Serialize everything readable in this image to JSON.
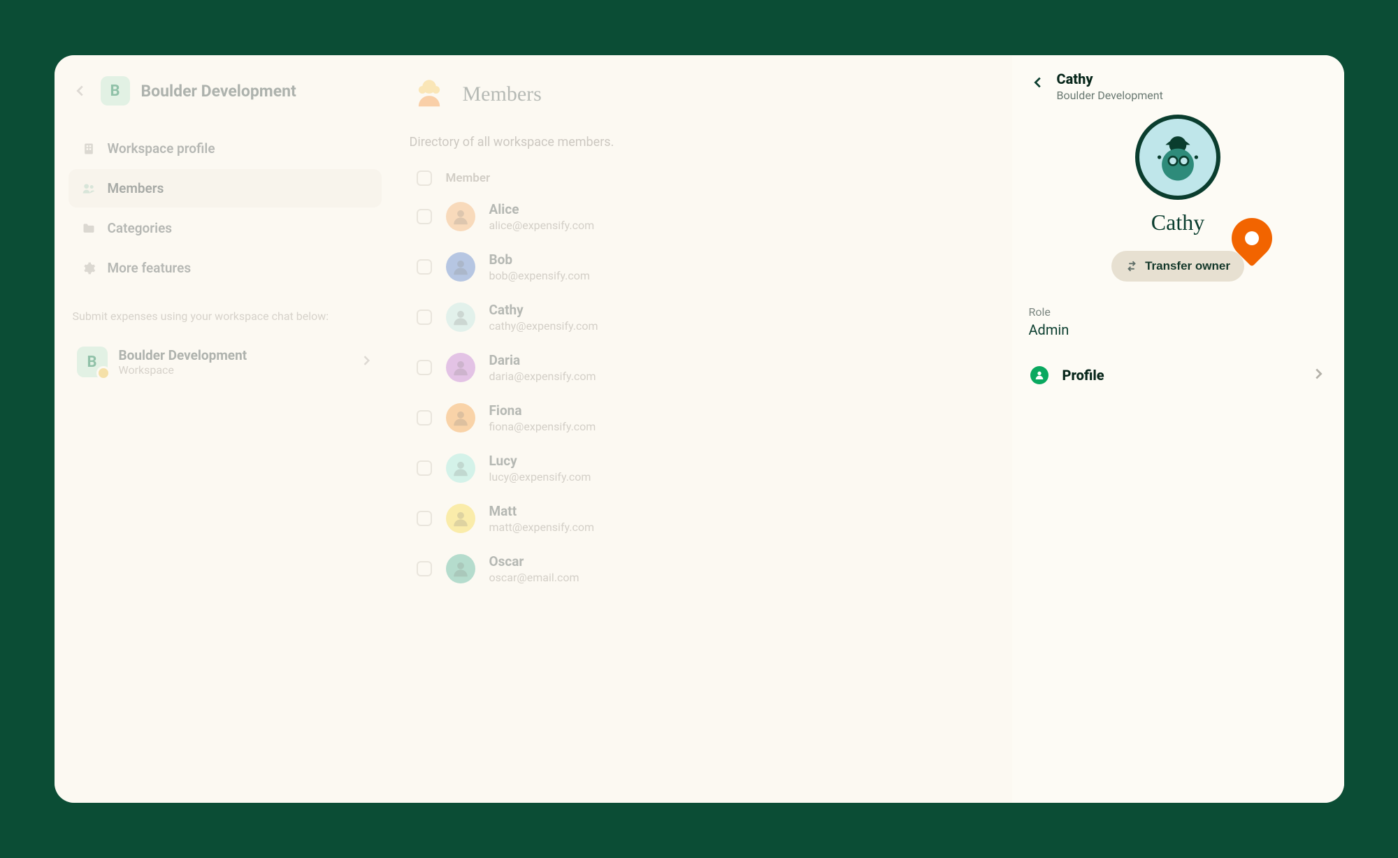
{
  "workspace": {
    "initial": "B",
    "name": "Boulder Development"
  },
  "sidebar": {
    "items": [
      {
        "label": "Workspace profile"
      },
      {
        "label": "Members"
      },
      {
        "label": "Categories"
      },
      {
        "label": "More features"
      }
    ],
    "hint": "Submit expenses using your workspace chat below:",
    "chat": {
      "initial": "B",
      "title": "Boulder Development",
      "subtitle": "Workspace"
    }
  },
  "members_section": {
    "title": "Members",
    "subtitle": "Directory of all workspace members.",
    "column_label": "Member",
    "rows": [
      {
        "name": "Alice",
        "email": "alice@expensify.com",
        "avatar": "av-orange"
      },
      {
        "name": "Bob",
        "email": "bob@expensify.com",
        "avatar": "av-blue"
      },
      {
        "name": "Cathy",
        "email": "cathy@expensify.com",
        "avatar": "av-teal"
      },
      {
        "name": "Daria",
        "email": "daria@expensify.com",
        "avatar": "av-purple"
      },
      {
        "name": "Fiona",
        "email": "fiona@expensify.com",
        "avatar": "av-amber"
      },
      {
        "name": "Lucy",
        "email": "lucy@expensify.com",
        "avatar": "av-mint"
      },
      {
        "name": "Matt",
        "email": "matt@expensify.com",
        "avatar": "av-yellow"
      },
      {
        "name": "Oscar",
        "email": "oscar@email.com",
        "avatar": "av-green"
      }
    ]
  },
  "detail": {
    "name": "Cathy",
    "subtitle": "Boulder Development",
    "transfer_label": "Transfer owner",
    "role_label": "Role",
    "role_value": "Admin",
    "profile_link": "Profile"
  }
}
